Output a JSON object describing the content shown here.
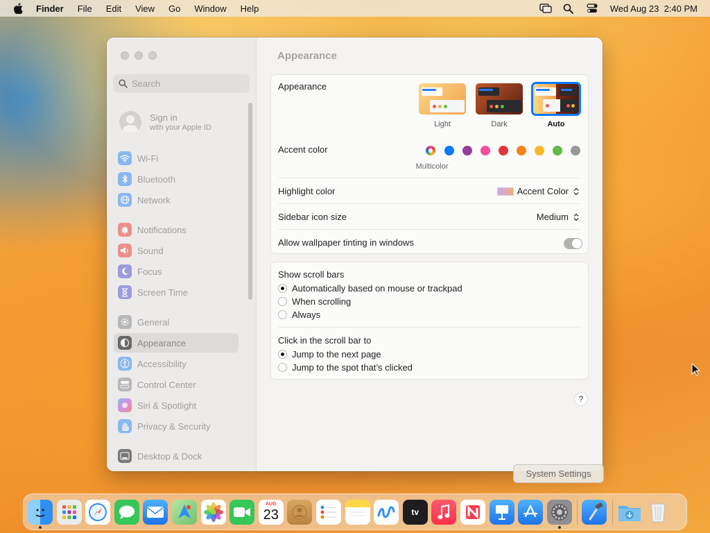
{
  "menubar": {
    "app_name": "Finder",
    "items": [
      "File",
      "Edit",
      "View",
      "Go",
      "Window",
      "Help"
    ],
    "clock": "Wed Aug 23  2:40 PM",
    "icons": [
      "apple-logo-icon",
      "screen-mirroring-icon",
      "spotlight-search-icon",
      "control-center-icon"
    ]
  },
  "sidebar": {
    "search_placeholder": "Search",
    "signin_title": "Sign in",
    "signin_subtitle": "with your Apple ID",
    "items": [
      {
        "label": "Wi-Fi",
        "icon": "wifi-icon",
        "color": "#3a8ef6"
      },
      {
        "label": "Bluetooth",
        "icon": "bluetooth-icon",
        "color": "#3a8ef6"
      },
      {
        "label": "Network",
        "icon": "globe-icon",
        "color": "#3a8ef6"
      },
      {
        "label": "Notifications",
        "icon": "bell-icon",
        "color": "#f0443a"
      },
      {
        "label": "Sound",
        "icon": "speaker-icon",
        "color": "#f0443a"
      },
      {
        "label": "Focus",
        "icon": "moon-icon",
        "color": "#5d5bd4"
      },
      {
        "label": "Screen Time",
        "icon": "hourglass-icon",
        "color": "#5d5bd4"
      },
      {
        "label": "General",
        "icon": "gear-icon",
        "color": "#8e8e93"
      },
      {
        "label": "Appearance",
        "icon": "appearance-icon",
        "color": "#1d1d1f"
      },
      {
        "label": "Accessibility",
        "icon": "accessibility-icon",
        "color": "#3a8ef6"
      },
      {
        "label": "Control Center",
        "icon": "control-center-icon",
        "color": "#8e8e93"
      },
      {
        "label": "Siri & Spotlight",
        "icon": "siri-icon",
        "color": "#c04ad8"
      },
      {
        "label": "Privacy & Security",
        "icon": "hand-icon",
        "color": "#3a8ef6"
      },
      {
        "label": "Desktop & Dock",
        "icon": "dock-icon",
        "color": "#1d1d1f"
      }
    ],
    "active": "Appearance"
  },
  "content": {
    "title": "Appearance",
    "appearance_label": "Appearance",
    "appearance_options": [
      {
        "label": "Light"
      },
      {
        "label": "Dark"
      },
      {
        "label": "Auto"
      }
    ],
    "appearance_selected": "Auto",
    "accent_label": "Accent color",
    "accent_caption": "Multicolor",
    "accent_colors": [
      "multicolor",
      "#0a7aff",
      "#953d96",
      "#f74f9e",
      "#e0383e",
      "#f7821b",
      "#fcb827",
      "#62ba46",
      "#989898"
    ],
    "highlight_label": "Highlight color",
    "highlight_value": "Accent Color",
    "sidebar_size_label": "Sidebar icon size",
    "sidebar_size_value": "Medium",
    "tinting_label": "Allow wallpaper tinting in windows",
    "tinting_on": false,
    "scroll_label": "Show scroll bars",
    "scroll_options": [
      "Automatically based on mouse or trackpad",
      "When scrolling",
      "Always"
    ],
    "scroll_selected": 0,
    "click_label": "Click in the scroll bar to",
    "click_options": [
      "Jump to the next page",
      "Jump to the spot that’s clicked"
    ],
    "click_selected": 0,
    "help": "?"
  },
  "tooltip": "System Settings",
  "dock": {
    "apps": [
      {
        "name": "finder-icon",
        "color": "#2f8ff2",
        "running": true
      },
      {
        "name": "launchpad-icon",
        "color": "#ebebeb"
      },
      {
        "name": "safari-icon",
        "color": "#ffffff"
      },
      {
        "name": "messages-icon",
        "color": "#35c759"
      },
      {
        "name": "mail-icon",
        "color": "#2a8cf0"
      },
      {
        "name": "maps-icon",
        "color": "#6dc46a"
      },
      {
        "name": "photos-icon",
        "color": "#ffffff"
      },
      {
        "name": "facetime-icon",
        "color": "#35c759"
      },
      {
        "name": "calendar-icon",
        "color": "#ffffff"
      },
      {
        "name": "contacts-icon",
        "color": "#c8964f"
      },
      {
        "name": "reminders-icon",
        "color": "#ffffff"
      },
      {
        "name": "notes-icon",
        "color": "#fcd847"
      },
      {
        "name": "freeform-icon",
        "color": "#ffffff"
      },
      {
        "name": "tv-icon",
        "color": "#1d1d1f"
      },
      {
        "name": "music-icon",
        "color": "#fa3c50"
      },
      {
        "name": "news-icon",
        "color": "#ffffff"
      },
      {
        "name": "keynote-icon",
        "color": "#2f8ff2"
      },
      {
        "name": "app-store-icon",
        "color": "#2a8cf0"
      },
      {
        "name": "system-settings-icon",
        "color": "#8e8e93",
        "running": true
      }
    ],
    "extras": [
      {
        "name": "xcode-icon",
        "color": "#2d7be0"
      },
      {
        "name": "downloads-folder-icon",
        "color": "#5fb3e8"
      },
      {
        "name": "trash-icon",
        "color": "#e6e6e6"
      }
    ],
    "calendar_month": "AUG",
    "calendar_day": "23",
    "tv_label": "tv"
  }
}
